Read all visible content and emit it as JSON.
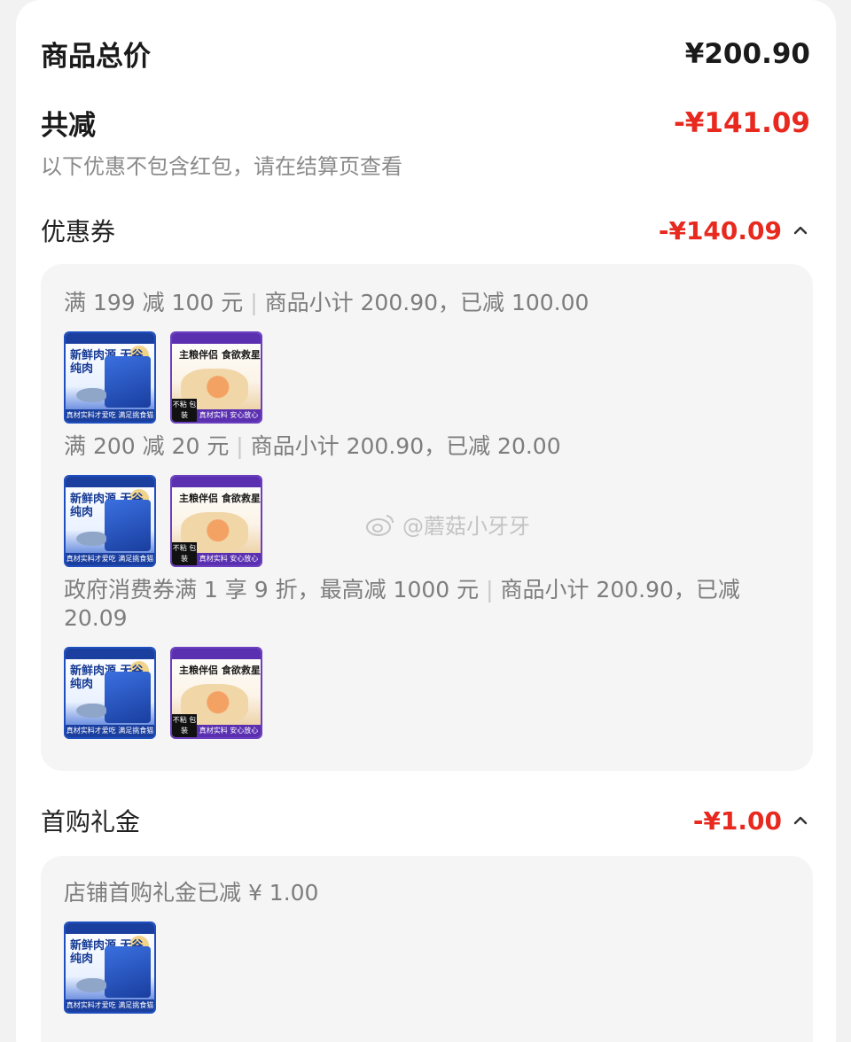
{
  "summary": {
    "total_label": "商品总价",
    "total_value": "¥200.90",
    "reduce_label": "共减",
    "reduce_value": "-¥141.09",
    "note": "以下优惠不包含红包，请在结算页查看"
  },
  "coupons": {
    "label": "优惠券",
    "value": "-¥140.09",
    "rules": [
      {
        "text": "满 199 减 100 元",
        "separator": "|",
        "detail": "商品小计 200.90，已减 100.00",
        "products": [
          "blue-pet-food",
          "purple-pet-food"
        ]
      },
      {
        "text": "满 200 减 20 元",
        "separator": "|",
        "detail": "商品小计 200.90，已减 20.00",
        "products": [
          "blue-pet-food",
          "purple-pet-food"
        ]
      },
      {
        "text": "政府消费券满 1 享 9 折，最高减 1000 元",
        "separator": "|",
        "detail": "商品小计 200.90，已减 20.09",
        "products": [
          "blue-pet-food",
          "purple-pet-food"
        ]
      }
    ]
  },
  "first_purchase": {
    "label": "首购礼金",
    "value": "-¥1.00",
    "rule": "店铺首购礼金已减 ¥ 1.00",
    "products": [
      "blue-pet-food"
    ]
  },
  "product_art": {
    "blue_title": "新鲜肉源 无谷纯肉",
    "blue_strip": "真材实料才爱吃 满足挑食猫",
    "purple_title": "主粮伴侣 食欲救星",
    "purple_tag": "不粘 包装",
    "purple_strip": "真材实料 安心放心"
  },
  "watermark": "@蘑菇小牙牙",
  "colors": {
    "discount_red": "#e8291f",
    "muted_text": "#7d7d7d"
  }
}
